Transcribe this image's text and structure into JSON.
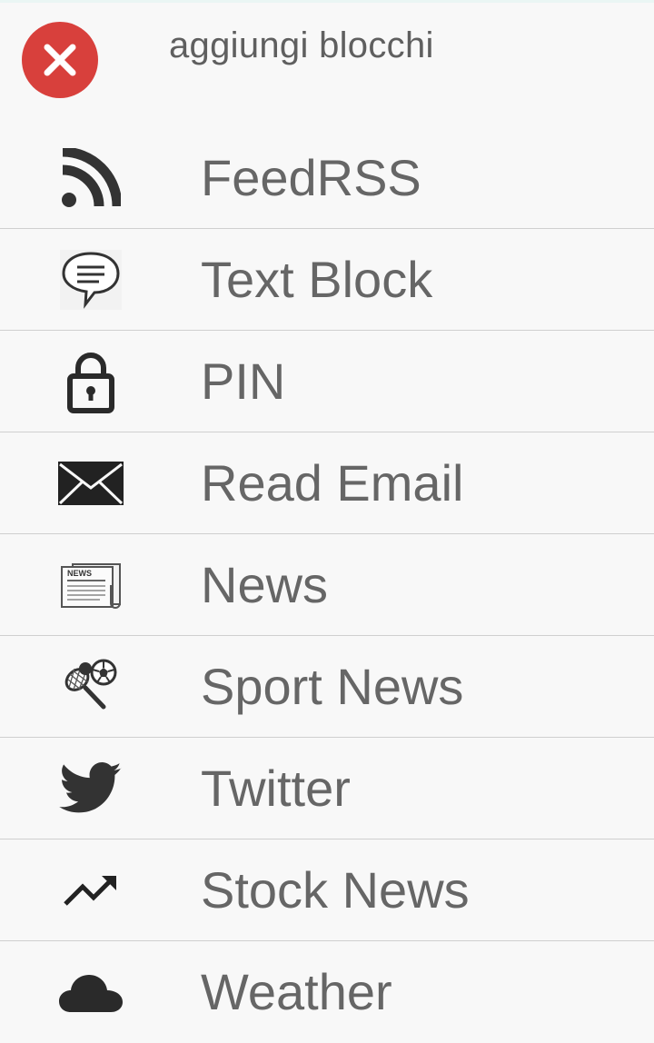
{
  "header": {
    "title": "aggiungi blocchi",
    "close_icon": "close-icon",
    "close_color": "#d8403c"
  },
  "items": [
    {
      "label": "FeedRSS",
      "icon": "rss-icon"
    },
    {
      "label": "Text Block",
      "icon": "speech-bubble-icon"
    },
    {
      "label": "PIN",
      "icon": "lock-icon"
    },
    {
      "label": "Read Email",
      "icon": "envelope-icon"
    },
    {
      "label": "News",
      "icon": "newspaper-icon",
      "icon_text": "NEWS"
    },
    {
      "label": "Sport News",
      "icon": "sports-balls-icon"
    },
    {
      "label": "Twitter",
      "icon": "twitter-bird-icon"
    },
    {
      "label": "Stock News",
      "icon": "trending-up-icon"
    },
    {
      "label": "Weather",
      "icon": "cloud-icon"
    }
  ],
  "colors": {
    "background": "#f8f8f8",
    "text": "#666666",
    "divider": "#cfcfcf",
    "icon": "#333333"
  }
}
